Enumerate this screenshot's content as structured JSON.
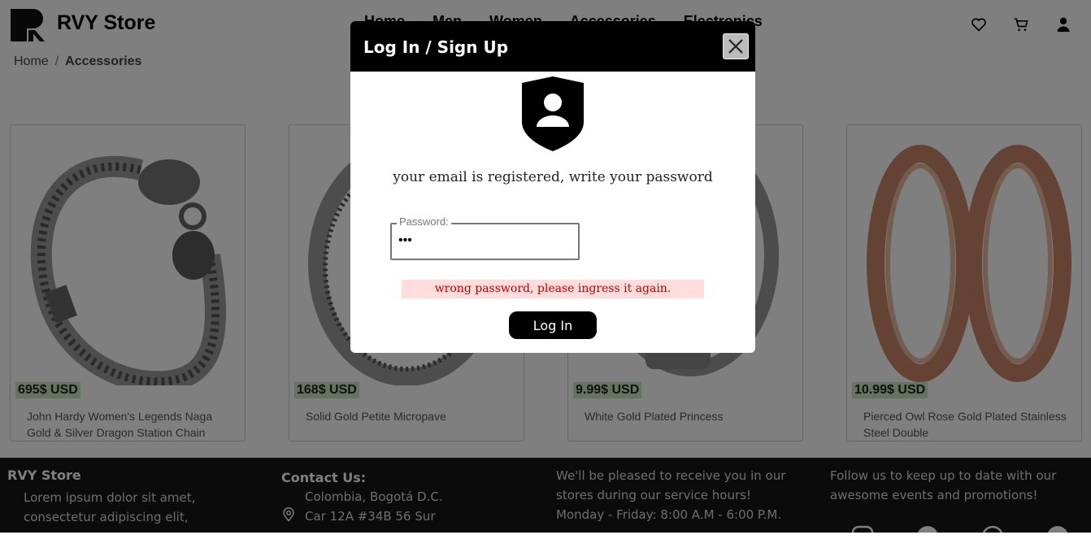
{
  "header": {
    "brand": "RVY Store",
    "nav": [
      "Home",
      "Men",
      "Women",
      "Accessories",
      "Electronics"
    ],
    "icons": [
      "heart-icon",
      "cart-icon",
      "user-icon"
    ]
  },
  "breadcrumb": {
    "home": "Home",
    "separator": "/",
    "current": "Accessories"
  },
  "products": [
    {
      "price": "695$ USD",
      "name": "John Hardy Women's Legends Naga Gold & Silver Dragon Station Chain"
    },
    {
      "price": "168$ USD",
      "name": "Solid Gold Petite Micropave"
    },
    {
      "price": "9.99$ USD",
      "name": "White Gold Plated Princess"
    },
    {
      "price": "10.99$ USD",
      "name": "Pierced Owl Rose Gold Plated Stainless Steel Double"
    }
  ],
  "footer": {
    "brand": "RVY Store",
    "about": "Lorem ipsum dolor sit amet, consectetur adipiscing elit,",
    "contact_title": "Contact Us:",
    "address_line1": "Colombia, Bogotá D.C.",
    "address_line2": "Car 12A #34B 56 Sur",
    "hours_text": "We'll be pleased to receive you in our stores during our service hours!",
    "hours": "Monday - Friday: 8:00 A.M - 6:00 P.M.",
    "follow_text": "Follow us to keep up to date with our awesome events and promotions!",
    "social_icons": [
      "instagram-icon",
      "facebook-icon",
      "youtube-icon",
      "twitter-icon"
    ]
  },
  "modal": {
    "title": "Log In / Sign Up",
    "message": "your email is registered, write your password",
    "password_label": "Password:",
    "password_value": "•••",
    "error": "wrong password, please ingress it again.",
    "login_button": "Log In"
  },
  "colors": {
    "price_bg": "#cfe6c5",
    "error_bg": "#ffdddd",
    "error_text": "#bb0000",
    "footer_bg": "#171717"
  }
}
